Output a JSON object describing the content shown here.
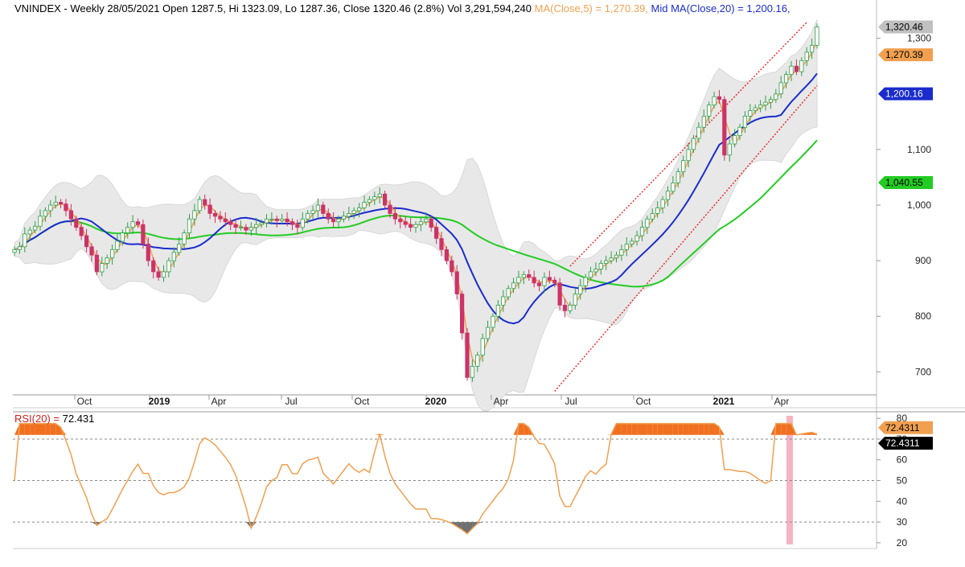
{
  "header": {
    "symbol": "VNINDEX",
    "period": "Weekly 28/05/2021",
    "ohlc": "Open 1287.5, Hi 1323.09, Lo 1287.36, Close 1320.46 (2.8%) Vol 3,291,594,240",
    "ma_label": "MA(Close,5) = 1,270.39,",
    "mid_ma_label": "Mid MA(Close,20) = 1,200.16,"
  },
  "colors": {
    "up": "#ffffff",
    "up_border": "#2e9e49",
    "down": "#cc3366",
    "ma5": "#f0a050",
    "mid_ma": "#1a2ccc",
    "ma_long": "#22cc22",
    "bands": "#e8e8e8",
    "channel": "#ee2222",
    "rsi": "#f0a050",
    "rsi_overbought": "#f07020",
    "rsi_oversold": "#707070",
    "highlight": "#f6b3c2"
  },
  "price_axis": {
    "ticks": [
      "1,300",
      "1,100",
      "1,000",
      "900",
      "800",
      "700"
    ],
    "tick_values": [
      1300,
      1100,
      1000,
      900,
      800,
      700
    ],
    "tags": [
      {
        "label": "1,320.46",
        "value": 1320.46,
        "color": "#c0c0c0",
        "text": "#000000"
      },
      {
        "label": "1,270.39",
        "value": 1270.39,
        "color": "#f0a050",
        "text": "#000000"
      },
      {
        "label": "1,200.16",
        "value": 1200.16,
        "color": "#1a2ccc",
        "text": "#ffffff"
      },
      {
        "label": "1,040.55",
        "value": 1040.55,
        "color": "#22cc22",
        "text": "#000000"
      }
    ]
  },
  "time_axis": {
    "labels": [
      {
        "text": "Oct",
        "bold": false
      },
      {
        "text": "2019",
        "bold": true
      },
      {
        "text": "Apr",
        "bold": false
      },
      {
        "text": "Jul",
        "bold": false
      },
      {
        "text": "Oct",
        "bold": false
      },
      {
        "text": "2020",
        "bold": true
      },
      {
        "text": "Apr",
        "bold": false
      },
      {
        "text": "Jul",
        "bold": false
      },
      {
        "text": "Oct",
        "bold": false
      },
      {
        "text": "2021",
        "bold": true
      },
      {
        "text": "Apr",
        "bold": false
      }
    ]
  },
  "rsi": {
    "label": "RSI(20) =",
    "value": "72.431",
    "ticks": [
      "80",
      "70",
      "60",
      "50",
      "40",
      "30",
      "20"
    ],
    "tick_values": [
      80,
      70,
      60,
      50,
      40,
      30,
      20
    ],
    "tag_values": [
      "72.4311",
      "72.4311"
    ]
  },
  "chart_data": {
    "type": "line",
    "title": "VNINDEX - Weekly 28/05/2021",
    "ylim": [
      660,
      1340
    ],
    "rsi_ylim": [
      18,
      82
    ],
    "series": [
      {
        "name": "Close",
        "values": [
          920,
          925,
          948,
          955,
          962,
          980,
          990,
          1000,
          1005,
          1002,
          990,
          975,
          960,
          945,
          925,
          910,
          880,
          895,
          905,
          920,
          935,
          950,
          960,
          970,
          965,
          930,
          900,
          880,
          870,
          880,
          900,
          915,
          930,
          950,
          975,
          990,
          1010,
          1000,
          985,
          980,
          975,
          970,
          965,
          960,
          960,
          955,
          960,
          965,
          968,
          975,
          975,
          972,
          975,
          970,
          965,
          960,
          975,
          985,
          990,
          1000,
          985,
          975,
          970,
          975,
          980,
          985,
          990,
          995,
          1005,
          1010,
          1015,
          1020,
          1000,
          985,
          975,
          970,
          965,
          960,
          965,
          970,
          975,
          960,
          940,
          920,
          900,
          880,
          840,
          770,
          690,
          710,
          730,
          760,
          780,
          800,
          820,
          835,
          850,
          860,
          870,
          875,
          870,
          860,
          855,
          870,
          865,
          860,
          820,
          810,
          820,
          840,
          855,
          870,
          880,
          885,
          895,
          900,
          905,
          910,
          920,
          930,
          935,
          945,
          960,
          975,
          985,
          995,
          1010,
          1025,
          1040,
          1060,
          1080,
          1100,
          1120,
          1140,
          1160,
          1180,
          1195,
          1190,
          1090,
          1110,
          1125,
          1140,
          1160,
          1170,
          1175,
          1180,
          1185,
          1190,
          1200,
          1220,
          1235,
          1250,
          1240,
          1260,
          1275,
          1287.5,
          1320.46
        ]
      },
      {
        "name": "MA(Close,5)",
        "values": [
          1270.39
        ]
      },
      {
        "name": "Mid MA(Close,20)",
        "values": [
          1200.16
        ]
      },
      {
        "name": "",
        "values": [
          1040.55
        ]
      },
      {
        "name": "RSI(20)",
        "values": [
          72.431
        ]
      }
    ]
  }
}
